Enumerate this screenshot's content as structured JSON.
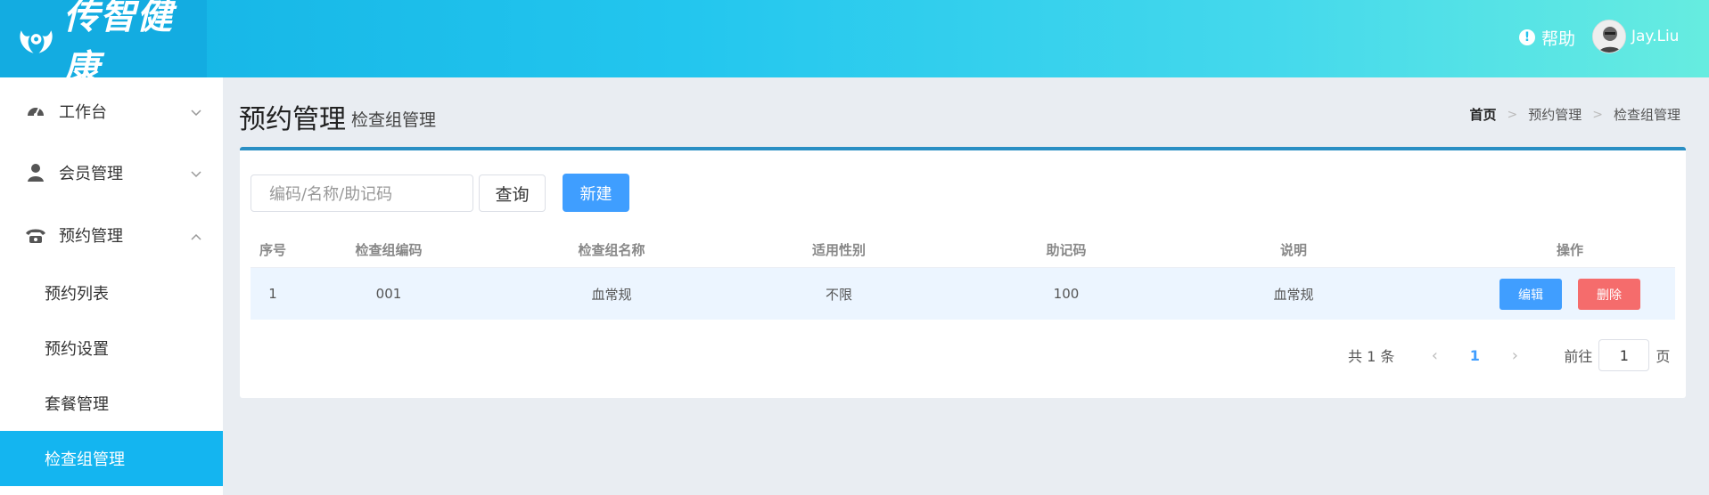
{
  "header": {
    "logo_text": "传智健康",
    "help_label": "帮助",
    "help_icon": "info-icon",
    "user_name": "Jay.Liu"
  },
  "sidebar": {
    "items": [
      {
        "label": "工作台",
        "icon": "dashboard-icon",
        "chevron": "chevron-down-icon"
      },
      {
        "label": "会员管理",
        "icon": "user-icon",
        "chevron": "chevron-down-icon"
      },
      {
        "label": "预约管理",
        "icon": "phone-icon",
        "chevron": "chevron-up-icon"
      }
    ],
    "sub_items": [
      {
        "label": "预约列表"
      },
      {
        "label": "预约设置"
      },
      {
        "label": "套餐管理"
      },
      {
        "label": "检查组管理",
        "active": true
      }
    ]
  },
  "page": {
    "title": "预约管理",
    "subtitle": "检查组管理"
  },
  "breadcrumb": [
    "首页",
    "预约管理",
    "检查组管理"
  ],
  "toolbar": {
    "search_placeholder": "编码/名称/助记码",
    "query_label": "查询",
    "new_label": "新建"
  },
  "table": {
    "headers": [
      "序号",
      "检查组编码",
      "检查组名称",
      "适用性别",
      "助记码",
      "说明",
      "操作"
    ],
    "rows": [
      [
        "1",
        "001",
        "血常规",
        "不限",
        "100",
        "血常规"
      ]
    ],
    "edit_label": "编辑",
    "delete_label": "删除"
  },
  "pagination": {
    "total_text": "共 1 条",
    "current_page": "1",
    "goto_label": "前往",
    "goto_value": "1",
    "page_suffix": "页"
  },
  "colors": {
    "accent": "#409eff",
    "danger": "#f56c6c",
    "sidebar_active": "#14b5f0",
    "panel_border": "#2a8fc4"
  }
}
